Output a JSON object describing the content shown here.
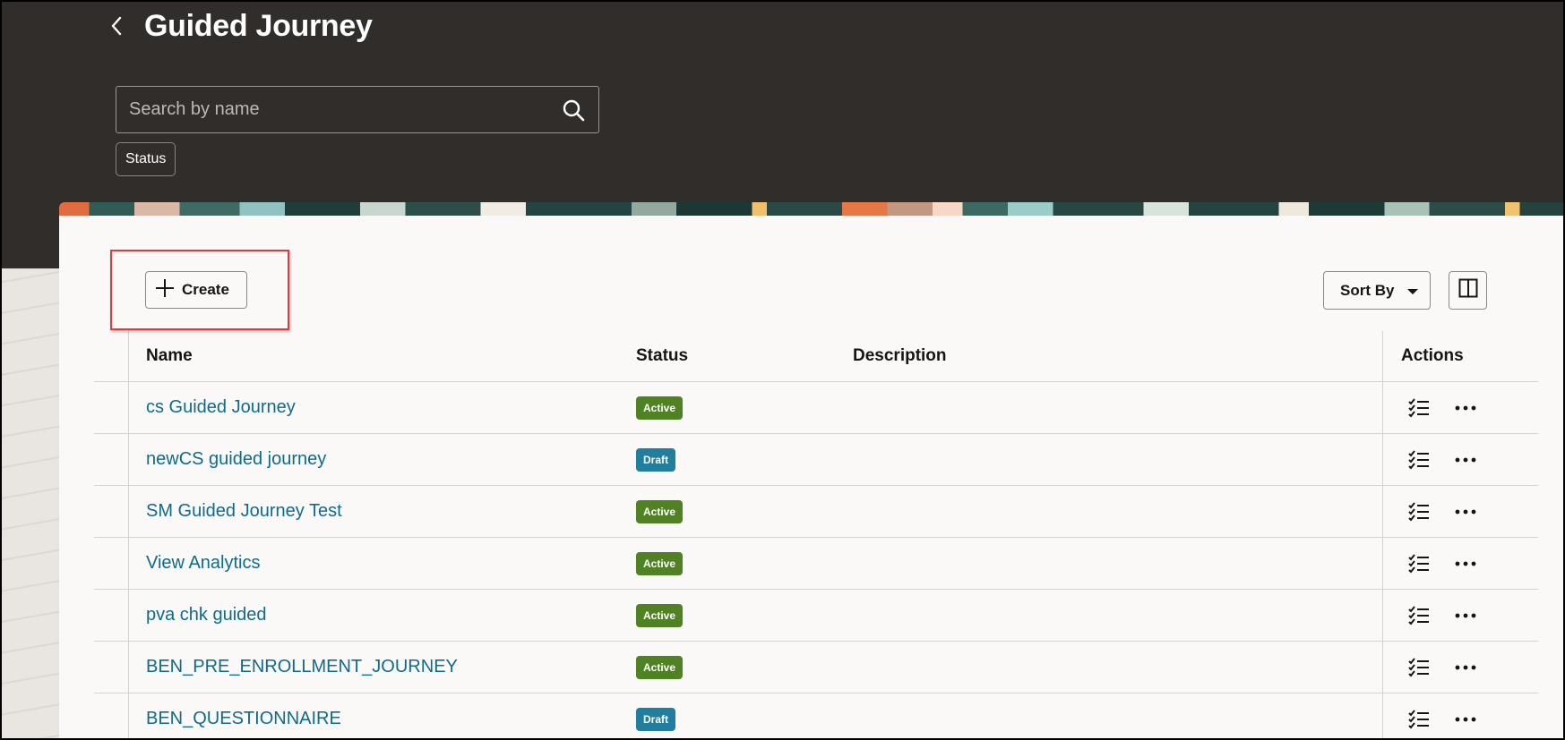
{
  "header": {
    "title": "Guided Journey",
    "search": {
      "placeholder": "Search by name",
      "value": ""
    },
    "filters": [
      {
        "label": "Status"
      }
    ]
  },
  "toolbar": {
    "create_label": "Create",
    "sort_label": "Sort By"
  },
  "table": {
    "columns": [
      "Name",
      "Status",
      "Description",
      "Actions"
    ],
    "rows": [
      {
        "name": "cs Guided Journey",
        "status": "Active",
        "description": ""
      },
      {
        "name": "newCS guided journey",
        "status": "Draft",
        "description": ""
      },
      {
        "name": "SM Guided Journey Test",
        "status": "Active",
        "description": ""
      },
      {
        "name": "View Analytics",
        "status": "Active",
        "description": ""
      },
      {
        "name": "pva chk guided",
        "status": "Active",
        "description": ""
      },
      {
        "name": "BEN_PRE_ENROLLMENT_JOURNEY",
        "status": "Active",
        "description": ""
      },
      {
        "name": "BEN_QUESTIONNAIRE",
        "status": "Draft",
        "description": ""
      }
    ]
  },
  "colors": {
    "header_bg": "#312d2a",
    "panel_bg": "#fbf9f8",
    "link": "#0e6b8c",
    "badge_active": "#508223",
    "badge_draft": "#227e9e",
    "highlight": "#e0393e"
  },
  "icons": {
    "back": "chevron-left-icon",
    "search": "search-icon",
    "create": "plus-icon",
    "sort": "caret-down-icon",
    "layout": "panel-layout-icon",
    "row_action_1": "checklist-icon",
    "row_action_2": "more-horizontal-icon"
  }
}
